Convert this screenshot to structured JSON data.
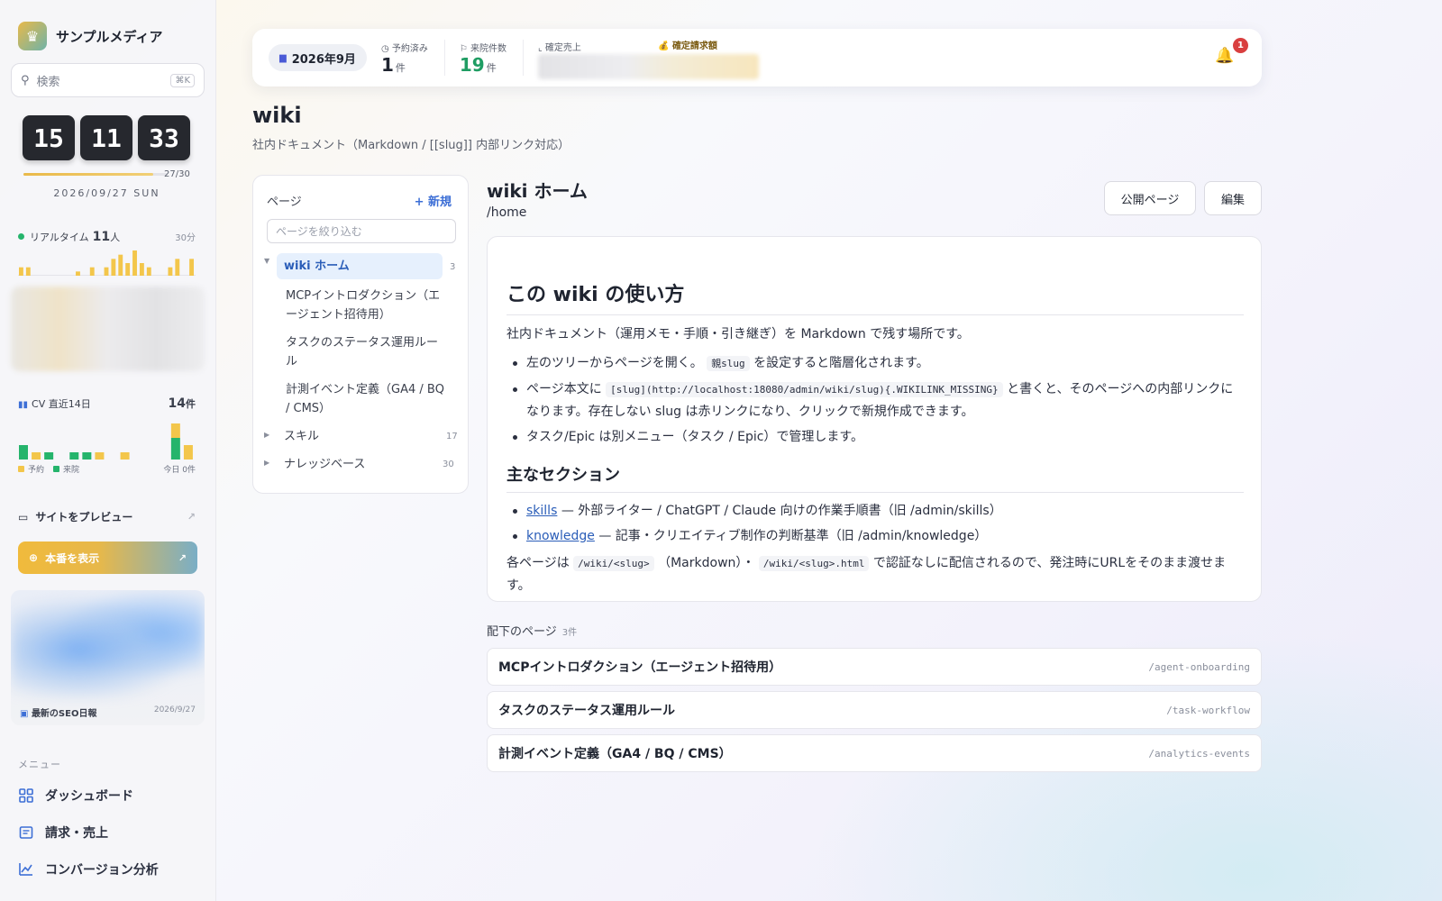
{
  "brand": {
    "name": "サンプルメディア",
    "logo_icon": "crown-icon"
  },
  "search": {
    "placeholder": "検索",
    "shortcut": "⌘K"
  },
  "clock": {
    "h": "15",
    "m": "11",
    "s": "33",
    "progress": "27/30",
    "progress_fraction": 0.9,
    "date": "2026/09/27 SUN"
  },
  "realtime": {
    "label": "リアルタイム",
    "count": "11",
    "unit": "人",
    "window": "30分",
    "bars": [
      2,
      2,
      0,
      0,
      0,
      0,
      0,
      0,
      1,
      0,
      2,
      0,
      2,
      4,
      5,
      3,
      6,
      3,
      2,
      0,
      0,
      2,
      4,
      0,
      4
    ]
  },
  "cv": {
    "label": "CV 直近14日",
    "count": "14",
    "unit": "件",
    "yoyaku": [
      0,
      1,
      0,
      0,
      0,
      0,
      1,
      0,
      1,
      0,
      0,
      0,
      2,
      2
    ],
    "raiin": [
      2,
      0,
      1,
      0,
      1,
      1,
      0,
      0,
      0,
      0,
      0,
      0,
      3,
      0
    ],
    "legend_yoyaku": "予約",
    "legend_raiin": "来院",
    "today": "今日 0件"
  },
  "sidebar": {
    "preview_label": "サイトをプレビュー",
    "production_label": "本番を表示",
    "seo_label": "最新のSEO日報",
    "seo_date": "2026/9/27",
    "menu_heading": "メニュー",
    "menu": [
      {
        "label": "ダッシュボード",
        "icon": "grid-icon"
      },
      {
        "label": "請求・売上",
        "icon": "invoice-icon"
      },
      {
        "label": "コンバージョン分析",
        "icon": "chart-line-icon"
      }
    ]
  },
  "topbar": {
    "month": "2026年9月",
    "reserved_label": "予約済み",
    "reserved_value": "1",
    "reserved_unit": "件",
    "visits_label": "来院件数",
    "visits_value": "19",
    "visits_unit": "件",
    "sales_label": "確定売上",
    "invoice_label": "確定請求額",
    "notifications": "1"
  },
  "page": {
    "title": "wiki",
    "subtitle": "社内ドキュメント（Markdown / [[slug]] 内部リンク対応）"
  },
  "tree": {
    "heading": "ページ",
    "new_label": "+ 新規",
    "filter_placeholder": "ページを絞り込む",
    "root": {
      "label": "wiki ホーム",
      "count": "3"
    },
    "children": [
      "MCPイントロダクション（エ\nージェント招待用）",
      "タスクのステータス運用ルー\nル",
      "計測イベント定義（GA4 / BQ\n/ CMS）"
    ],
    "skills": {
      "label": "スキル",
      "count": "17"
    },
    "knowledge": {
      "label": "ナレッジベース",
      "count": "30"
    }
  },
  "doc": {
    "title": "wiki ホーム",
    "slug": "/home",
    "public_button": "公開ページ",
    "edit_button": "編集",
    "h1": "この wiki の使い方",
    "intro": "社内ドキュメント（運用メモ・手順・引き継ぎ）を Markdown で残す場所です。",
    "li1_a": "左のツリーからページを開く。",
    "li1_code": "親slug",
    "li1_b": " を設定すると階層化されます。",
    "li2_a": "ページ本文に ",
    "li2_code": "[slug](http://localhost:18080/admin/wiki/slug){.WIKILINK_MISSING}",
    "li2_b": " と書くと、そのページへの内部リンクになります。存在しない slug は赤リンクになり、クリックで新規作成できます。",
    "li3": "タスク/Epic は別メニュー（タスク / Epic）で管理します。",
    "h2": "主なセクション",
    "s1_link": "skills",
    "s1_text": " — 外部ライター / ChatGPT / Claude 向けの作業手順書（旧 /admin/skills）",
    "s2_link": "knowledge",
    "s2_text": " — 記事・クリエイティブ制作の判断基準（旧 /admin/knowledge）",
    "foot_a": "各ページは ",
    "foot_code1": "/wiki/<slug>",
    "foot_b": " （Markdown）・ ",
    "foot_code2": "/wiki/<slug>.html",
    "foot_c": " で認証なしに配信されるので、発注時にURLをそのまま渡せます。"
  },
  "subpages": {
    "heading": "配下のページ",
    "count": "3件",
    "items": [
      {
        "title": "MCPイントロダクション（エージェント招待用）",
        "slug": "/agent-onboarding"
      },
      {
        "title": "タスクのステータス運用ルール",
        "slug": "/task-workflow"
      },
      {
        "title": "計測イベント定義（GA4 / BQ / CMS）",
        "slug": "/analytics-events"
      }
    ]
  },
  "colors": {
    "accent": "#3d6fd6",
    "yellow": "#f3c64b",
    "green": "#25b46c",
    "badge": "#d93f3f"
  }
}
